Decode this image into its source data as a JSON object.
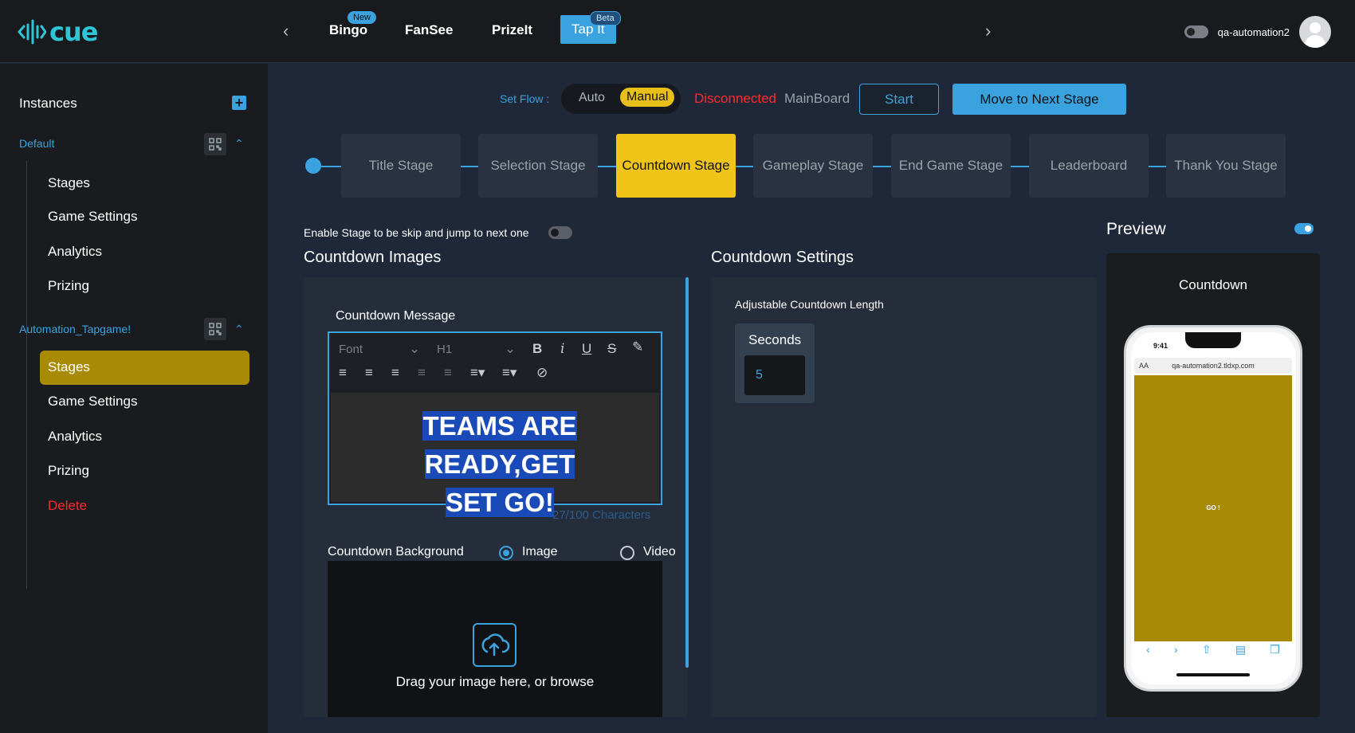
{
  "app": {
    "logo_text": "cue"
  },
  "topnav": {
    "tabs": [
      {
        "label": "Bingo",
        "badge": "New"
      },
      {
        "label": "FanSee"
      },
      {
        "label": "PrizeIt"
      },
      {
        "label": "Tap It",
        "badge": "Beta",
        "active": true
      }
    ],
    "username": "qa-automation2"
  },
  "sidebar": {
    "title": "Instances",
    "instances": [
      {
        "name": "Default",
        "items": [
          "Stages",
          "Game Settings",
          "Analytics",
          "Prizing"
        ]
      },
      {
        "name": "Automation_Tapgame!",
        "items": [
          "Stages",
          "Game Settings",
          "Analytics",
          "Prizing",
          "Delete"
        ],
        "active_item": "Stages"
      }
    ]
  },
  "flow": {
    "label": "Set Flow :",
    "options": [
      "Auto",
      "Manual"
    ],
    "selected": "Manual",
    "status": "Disconnected",
    "board": "MainBoard",
    "start_label": "Start",
    "next_label": "Move to Next Stage"
  },
  "stages": [
    "Title Stage",
    "Selection Stage",
    "Countdown Stage",
    "Gameplay Stage",
    "End Game Stage",
    "Leaderboard",
    "Thank You Stage"
  ],
  "active_stage": "Countdown Stage",
  "skip_label": "Enable Stage to be skip and jump to next one",
  "images": {
    "heading": "Countdown Images",
    "message_label": "Countdown Message",
    "font_placeholder": "Font",
    "heading_select": "H1",
    "message_line1": "TEAMS ARE READY,GET",
    "message_line2": "SET GO!",
    "char_count": "27/100 Characters",
    "background_label": "Countdown Background",
    "radio_image": "Image",
    "radio_video": "Video",
    "upload_text": "Drag your image here, or browse"
  },
  "settings": {
    "heading": "Countdown Settings",
    "length_label": "Adjustable Countdown Length",
    "seconds_label": "Seconds",
    "seconds_value": "5"
  },
  "preview": {
    "heading": "Preview",
    "title": "Countdown",
    "phone_time": "9:41",
    "phone_url": "qa-automation2.tldxp.com",
    "phone_text": "GO !",
    "url_aa": "AA"
  },
  "colors": {
    "accent": "#3aa2de",
    "gold": "#f0c419",
    "danger": "#ff2a2a"
  }
}
